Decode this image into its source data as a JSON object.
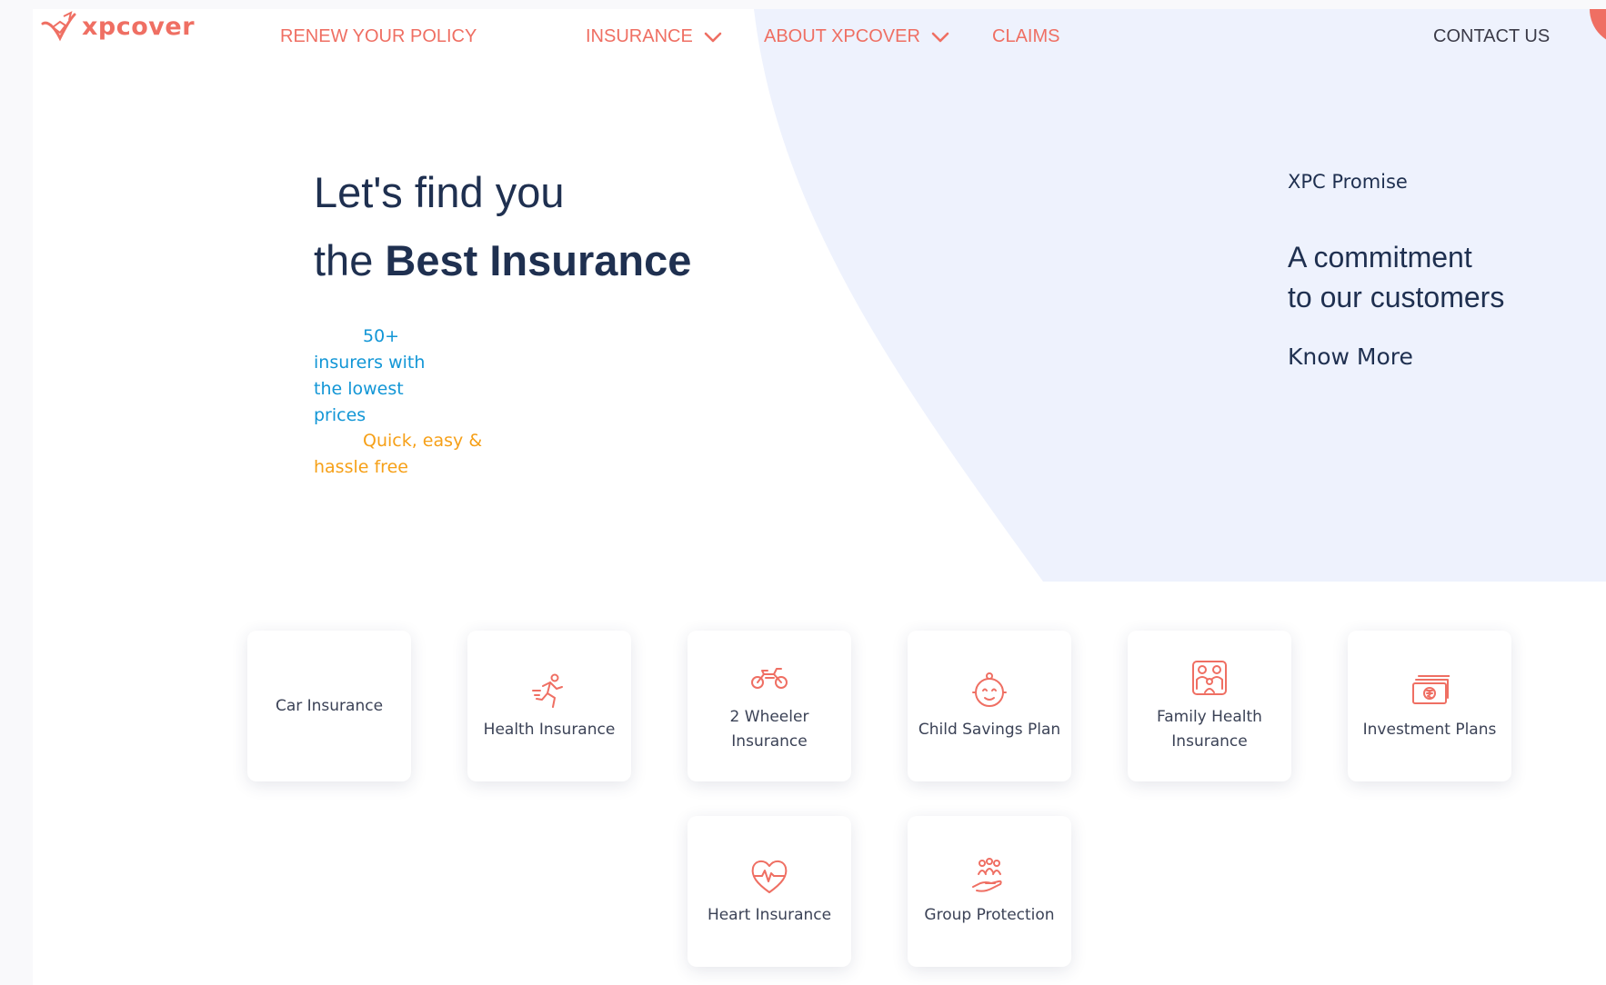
{
  "brand": {
    "name": "xpcover",
    "accent_color": "#ef6f63"
  },
  "nav": {
    "items": [
      {
        "label": "RENEW YOUR POLICY"
      },
      {
        "label": "INSURANCE"
      },
      {
        "label": "ABOUT XPCOVER"
      },
      {
        "label": "CLAIMS"
      },
      {
        "label": "CONTACT US"
      }
    ]
  },
  "hero": {
    "line1": "Let's find you",
    "line2_prefix": "the ",
    "line2_bold": "Best Insurance",
    "features": [
      {
        "text": "50+ insurers with the lowest prices",
        "color": "#1296d6"
      },
      {
        "text": "Quick, easy & hassle free",
        "color": "#f6a018"
      }
    ]
  },
  "promise": {
    "title": "XPC Promise",
    "line1": "A commitment",
    "line2": "to our customers",
    "link": "Know More"
  },
  "products": [
    {
      "label": "Car Insurance",
      "icon": "car-icon"
    },
    {
      "label": "Health Insurance",
      "icon": "running-person-icon"
    },
    {
      "label": "2 Wheeler Insurance",
      "icon": "motorcycle-icon"
    },
    {
      "label": "Child Savings Plan",
      "icon": "baby-face-icon"
    },
    {
      "label": "Family Health Insurance",
      "icon": "family-icon"
    },
    {
      "label": "Investment Plans",
      "icon": "rupee-notes-icon"
    },
    {
      "label": "Heart Insurance",
      "icon": "heartbeat-icon"
    },
    {
      "label": "Group Protection",
      "icon": "group-hand-icon"
    }
  ],
  "colors": {
    "hero_bg": "#eef2fd",
    "heading": "#1f3050",
    "card_text": "#3b4256"
  }
}
